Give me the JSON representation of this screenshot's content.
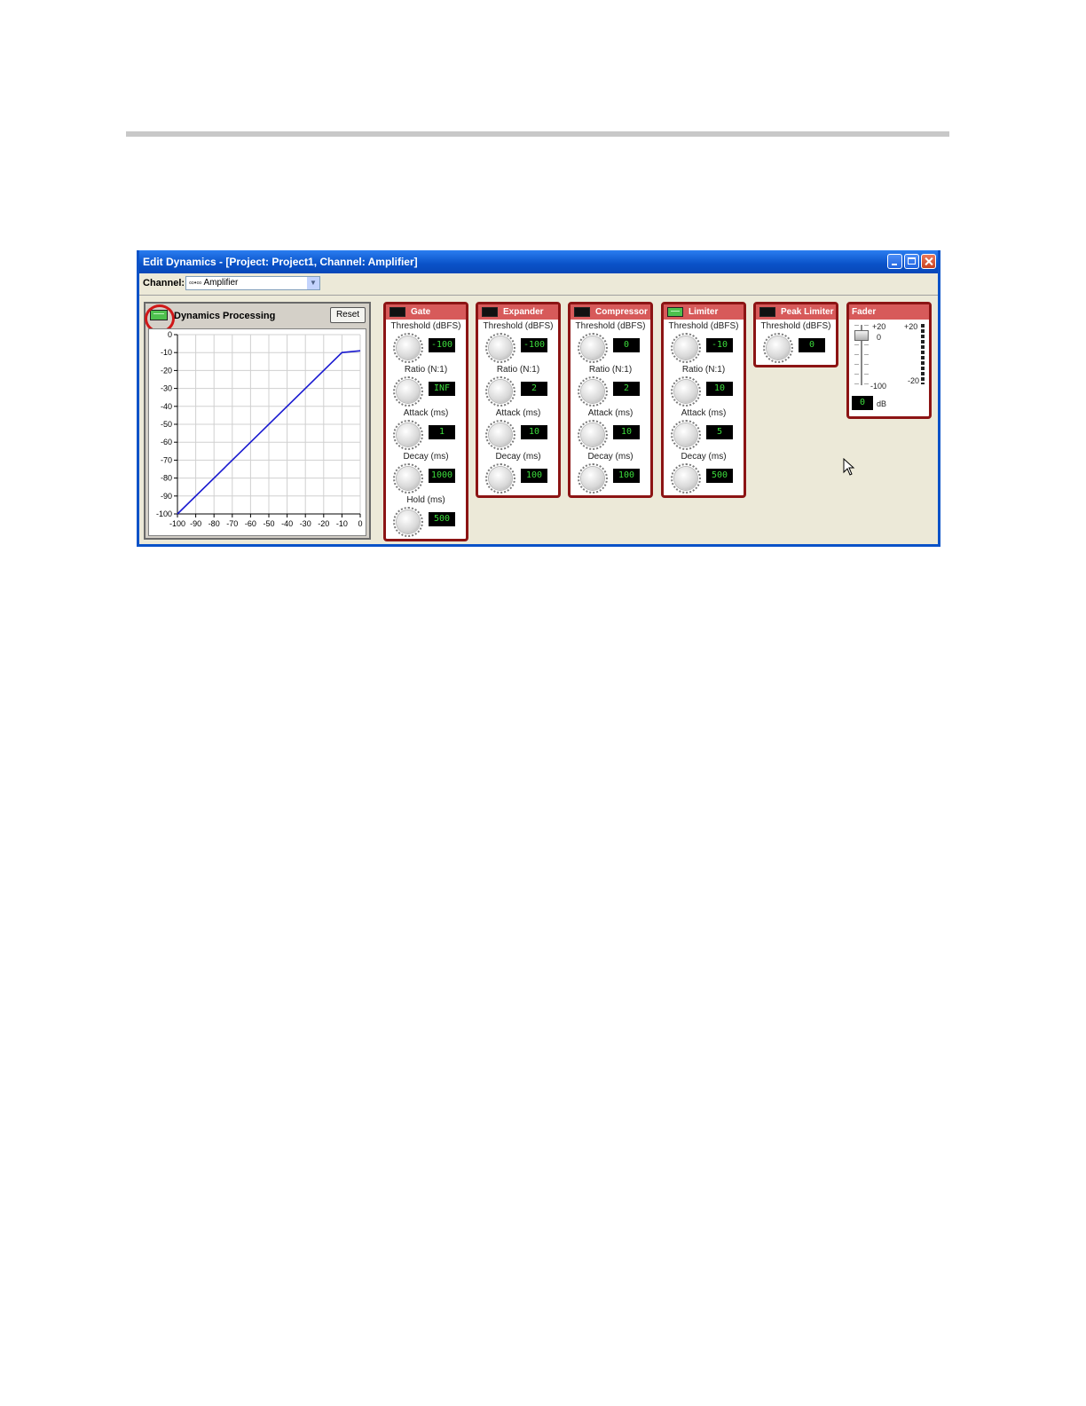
{
  "window": {
    "title": "Edit Dynamics - [Project: Project1, Channel: Amplifier]"
  },
  "channel": {
    "label": "Channel:",
    "selected": "Amplifier",
    "icon": "channel-link-icon"
  },
  "dynamics": {
    "title": "Dynamics Processing",
    "enabled": true,
    "reset_label": "Reset"
  },
  "chart_data": {
    "type": "line",
    "title": "",
    "xlabel": "",
    "ylabel": "",
    "xlim": [
      -100,
      0
    ],
    "ylim": [
      -100,
      0
    ],
    "x_ticks": [
      "-100",
      "-90",
      "-80",
      "-70",
      "-60",
      "-50",
      "-40",
      "-30",
      "-20",
      "-10",
      "0"
    ],
    "y_ticks": [
      "0",
      "-10",
      "-20",
      "-30",
      "-40",
      "-50",
      "-60",
      "-70",
      "-80",
      "-90",
      "-100"
    ],
    "grid": true,
    "series": [
      {
        "color": "#1a1ad0",
        "x": [
          -100,
          -10,
          0
        ],
        "y": [
          -100,
          -10,
          -9
        ]
      }
    ]
  },
  "modules": [
    {
      "name": "Gate",
      "enabled": false,
      "params": [
        {
          "label": "Threshold (dBFS)",
          "value": "-100"
        },
        {
          "label": "Ratio (N:1)",
          "value": "INF"
        },
        {
          "label": "Attack (ms)",
          "value": "1"
        },
        {
          "label": "Decay (ms)",
          "value": "1000"
        },
        {
          "label": "Hold (ms)",
          "value": "500"
        }
      ]
    },
    {
      "name": "Expander",
      "enabled": false,
      "params": [
        {
          "label": "Threshold (dBFS)",
          "value": "-100"
        },
        {
          "label": "Ratio (N:1)",
          "value": "2"
        },
        {
          "label": "Attack (ms)",
          "value": "10"
        },
        {
          "label": "Decay (ms)",
          "value": "100"
        }
      ]
    },
    {
      "name": "Compressor",
      "enabled": false,
      "params": [
        {
          "label": "Threshold (dBFS)",
          "value": "0"
        },
        {
          "label": "Ratio (N:1)",
          "value": "2"
        },
        {
          "label": "Attack (ms)",
          "value": "10"
        },
        {
          "label": "Decay (ms)",
          "value": "100"
        }
      ]
    },
    {
      "name": "Limiter",
      "enabled": true,
      "params": [
        {
          "label": "Threshold (dBFS)",
          "value": "-10"
        },
        {
          "label": "Ratio (N:1)",
          "value": "10"
        },
        {
          "label": "Attack (ms)",
          "value": "5"
        },
        {
          "label": "Decay (ms)",
          "value": "500"
        }
      ]
    },
    {
      "name": "Peak Limiter",
      "enabled": false,
      "params": [
        {
          "label": "Threshold (dBFS)",
          "value": "0"
        }
      ]
    }
  ],
  "fader": {
    "title": "Fader",
    "scale_top": "+20",
    "scale_zero": "0",
    "scale_bottom": "-100",
    "meter_top": "+20",
    "meter_bottom": "-20",
    "value": "0",
    "unit": "dB"
  }
}
